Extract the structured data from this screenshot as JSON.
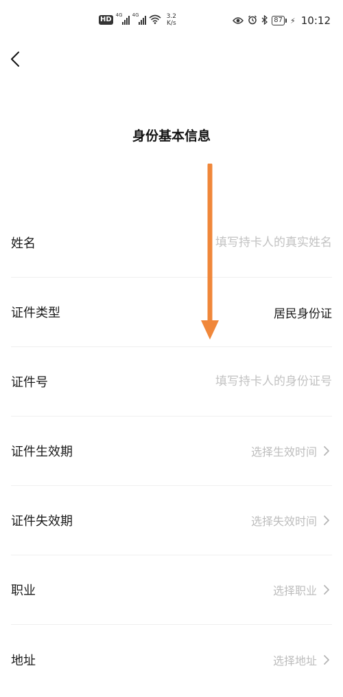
{
  "status_bar": {
    "hd": "HD",
    "net1": "4G",
    "net2": "4G",
    "speed_value": "3.2",
    "speed_unit": "K/s",
    "battery": "87",
    "time": "10:12"
  },
  "page": {
    "title": "身份基本信息"
  },
  "form": {
    "name": {
      "label": "姓名",
      "placeholder": "填写持卡人的真实姓名",
      "value": ""
    },
    "id_type": {
      "label": "证件类型",
      "value": "居民身份证"
    },
    "id_number": {
      "label": "证件号",
      "placeholder": "填写持卡人的身份证号",
      "value": ""
    },
    "valid_from": {
      "label": "证件生效期",
      "placeholder": "选择生效时间"
    },
    "valid_to": {
      "label": "证件失效期",
      "placeholder": "选择失效时间"
    },
    "occupation": {
      "label": "职业",
      "placeholder": "选择职业"
    },
    "address": {
      "label": "地址",
      "placeholder": "选择地址"
    }
  },
  "colors": {
    "annotation_arrow": "#f0873a",
    "placeholder": "#bdbdbd",
    "divider": "#efefef"
  }
}
